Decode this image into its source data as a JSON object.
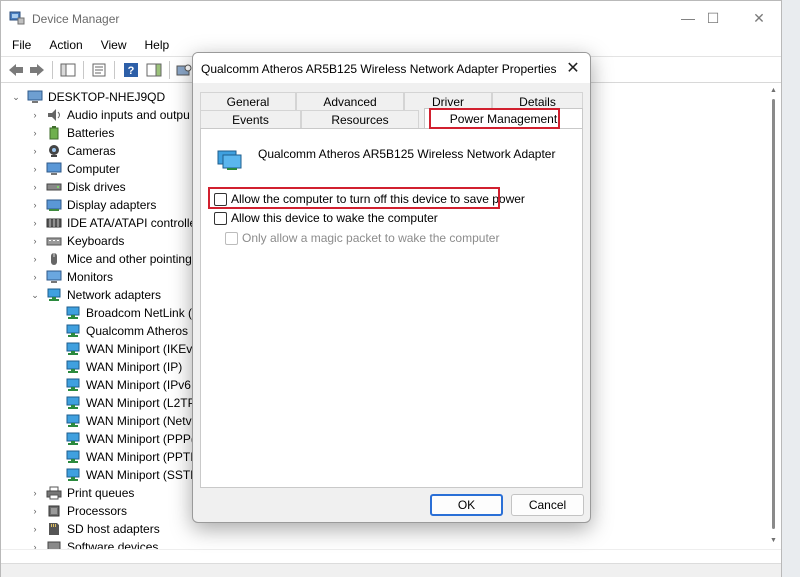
{
  "window": {
    "title": "Device Manager"
  },
  "menu": [
    "File",
    "Action",
    "View",
    "Help"
  ],
  "tree": {
    "root": "DESKTOP-NHEJ9QD",
    "categories": [
      "Audio inputs and outpu",
      "Batteries",
      "Cameras",
      "Computer",
      "Disk drives",
      "Display adapters",
      "IDE ATA/ATAPI controlle",
      "Keyboards",
      "Mice and other pointing",
      "Monitors",
      "Network adapters"
    ],
    "network_children": [
      "Broadcom NetLink (",
      "Qualcomm Atheros",
      "WAN Miniport (IKEv",
      "WAN Miniport (IP)",
      "WAN Miniport (IPv6",
      "WAN Miniport (L2TP",
      "WAN Miniport (Netv",
      "WAN Miniport (PPP(",
      "WAN Miniport (PPTI",
      "WAN Miniport (SSTP"
    ],
    "after_categories": [
      "Print queues",
      "Processors",
      "SD host adapters",
      "Software devices"
    ]
  },
  "dialog": {
    "title": "Qualcomm Atheros AR5B125 Wireless Network Adapter Properties",
    "tabs_row1": [
      "General",
      "Advanced",
      "Driver",
      "Details"
    ],
    "tabs_row2": [
      "Events",
      "Resources",
      "Power Management"
    ],
    "device_name": "Qualcomm Atheros AR5B125 Wireless Network Adapter",
    "options": [
      {
        "label": "Allow the computer to turn off this device to save power",
        "checked": false,
        "enabled": true
      },
      {
        "label": "Allow this device to wake the computer",
        "checked": false,
        "enabled": true
      },
      {
        "label": "Only allow a magic packet to wake the computer",
        "checked": false,
        "enabled": false
      }
    ],
    "ok_label": "OK",
    "cancel_label": "Cancel"
  },
  "colors": {
    "highlight": "#d1202f",
    "accent": "#2a6fd6"
  },
  "icons": {
    "close": "✕",
    "minimize": "—",
    "maximize": "☐",
    "chevron_right": "›",
    "chevron_down": "⌄"
  }
}
